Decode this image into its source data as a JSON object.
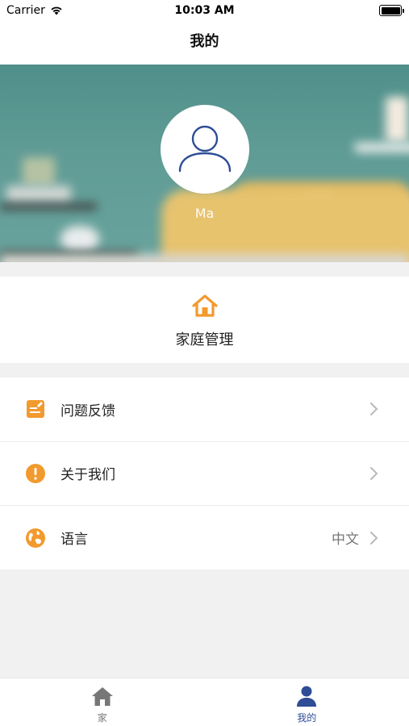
{
  "status_bar": {
    "carrier": "Carrier",
    "time": "10:03 AM",
    "wifi_icon": "wifi-icon",
    "battery_icon": "battery-icon"
  },
  "nav": {
    "title": "我的"
  },
  "profile": {
    "avatar_icon": "user-outline-icon",
    "username": "Ma"
  },
  "family": {
    "icon": "home-icon",
    "label": "家庭管理",
    "accent_color": "#f29a2e"
  },
  "menu": {
    "items": [
      {
        "icon": "feedback-icon",
        "label": "问题反馈",
        "value": ""
      },
      {
        "icon": "info-icon",
        "label": "关于我们",
        "value": ""
      },
      {
        "icon": "globe-icon",
        "label": "语言",
        "value": "中文"
      }
    ]
  },
  "tabbar": {
    "tabs": [
      {
        "icon": "home-filled-icon",
        "label": "家",
        "active": false
      },
      {
        "icon": "person-filled-icon",
        "label": "我的",
        "active": true
      }
    ],
    "active_color": "#2e4d96",
    "inactive_color": "#777777"
  }
}
